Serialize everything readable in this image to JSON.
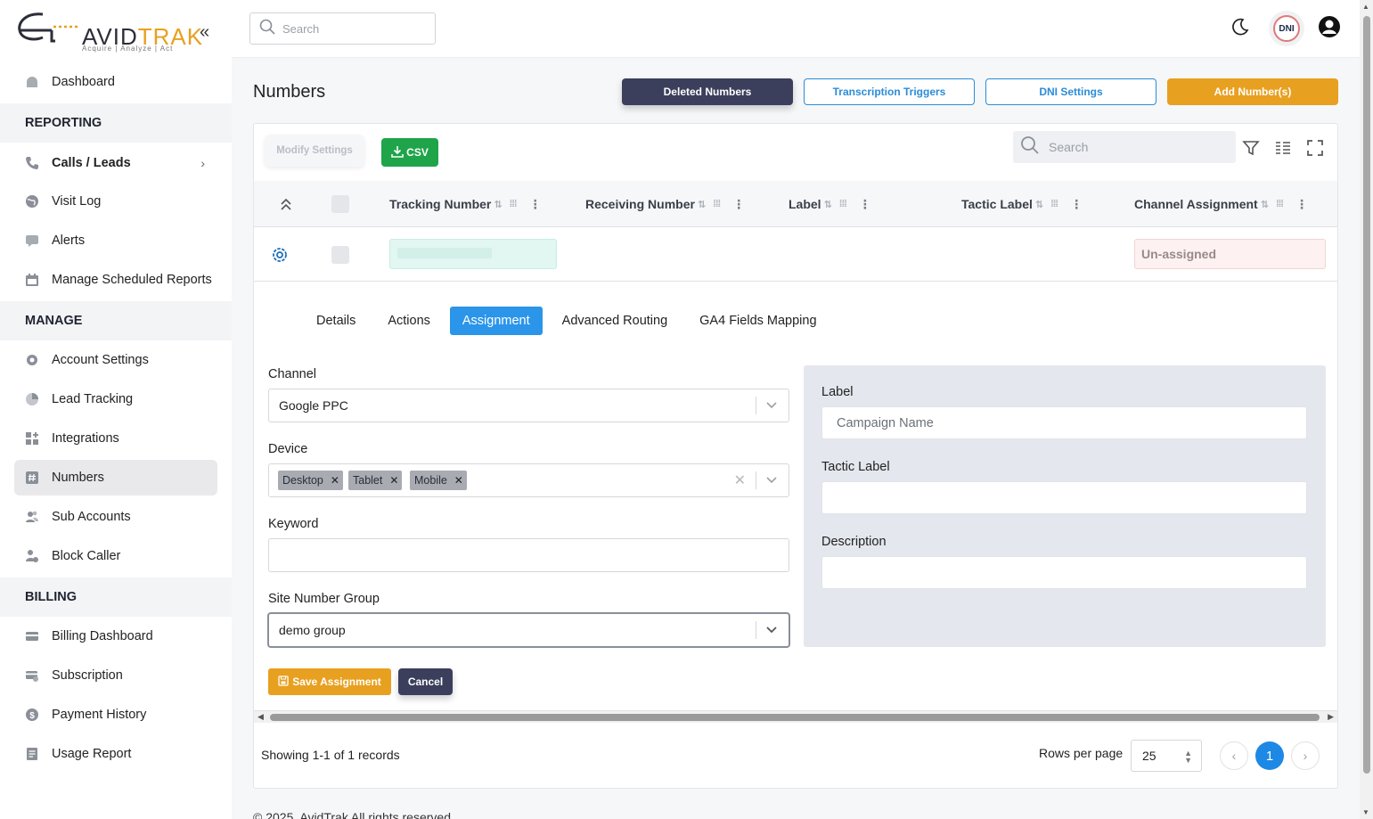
{
  "brand": {
    "name_avid": "AVID",
    "name_trak": "TRAK",
    "tagline": "Acquire  |  Analyze  |  Act"
  },
  "sidebar": {
    "items_top": [
      {
        "label": "Dashboard",
        "icon": "dashboard-icon"
      }
    ],
    "sections": {
      "reporting": "REPORTING",
      "manage": "MANAGE",
      "billing": "BILLING"
    },
    "reporting_items": [
      {
        "label": "Calls / Leads",
        "icon": "phone-icon"
      },
      {
        "label": "Visit Log",
        "icon": "globe-icon"
      },
      {
        "label": "Alerts",
        "icon": "chat-icon"
      },
      {
        "label": "Manage Scheduled Reports",
        "icon": "calendar-icon"
      }
    ],
    "manage_items": [
      {
        "label": "Account Settings",
        "icon": "gear-icon"
      },
      {
        "label": "Lead Tracking",
        "icon": "pie-chart-icon"
      },
      {
        "label": "Integrations",
        "icon": "grid-plus-icon"
      },
      {
        "label": "Numbers",
        "icon": "hash-icon",
        "active": true
      },
      {
        "label": "Sub Accounts",
        "icon": "users-icon"
      },
      {
        "label": "Block Caller",
        "icon": "user-block-icon"
      }
    ],
    "billing_items": [
      {
        "label": "Billing Dashboard",
        "icon": "credit-card-icon"
      },
      {
        "label": "Subscription",
        "icon": "card-sync-icon"
      },
      {
        "label": "Payment History",
        "icon": "dollar-icon"
      },
      {
        "label": "Usage Report",
        "icon": "report-icon"
      }
    ]
  },
  "topbar": {
    "search_placeholder": "Search",
    "dni_label": "DNI"
  },
  "page": {
    "title": "Numbers",
    "buttons": {
      "deleted": "Deleted Numbers",
      "transcription": "Transcription Triggers",
      "dni_settings": "DNI Settings",
      "add": "Add Number(s)"
    }
  },
  "table": {
    "modify_label": "Modify Settings",
    "csv_label": "CSV",
    "search_placeholder": "Search",
    "columns": [
      "Tracking Number",
      "Receiving Number",
      "Label",
      "Tactic Label",
      "Channel Assignment"
    ],
    "row": {
      "channel_assignment": "Un-assigned"
    }
  },
  "detail": {
    "tabs": [
      "Details",
      "Actions",
      "Assignment",
      "Advanced Routing",
      "GA4 Fields Mapping"
    ],
    "active_tab": "Assignment",
    "channel": {
      "label": "Channel",
      "value": "Google PPC"
    },
    "device": {
      "label": "Device",
      "values": [
        "Desktop",
        "Tablet",
        "Mobile"
      ]
    },
    "keyword": {
      "label": "Keyword",
      "value": ""
    },
    "site_group": {
      "label": "Site Number Group",
      "value": "demo group"
    },
    "label_field": {
      "label": "Label",
      "placeholder": "Campaign Name"
    },
    "tactic_label": {
      "label": "Tactic Label",
      "value": ""
    },
    "description": {
      "label": "Description",
      "value": ""
    },
    "save_label": "Save Assignment",
    "cancel_label": "Cancel"
  },
  "pagination": {
    "showing": "Showing 1-1 of 1 records",
    "rows_label": "Rows per page",
    "rows_value": "25",
    "current_page": "1"
  },
  "footer": "© 2025, AvidTrak All rights reserved",
  "colors": {
    "accent_orange": "#e8a020",
    "primary_blue": "#2b95e9",
    "dark_navy": "#3b3f5c",
    "csv_green": "#1fa44a"
  }
}
